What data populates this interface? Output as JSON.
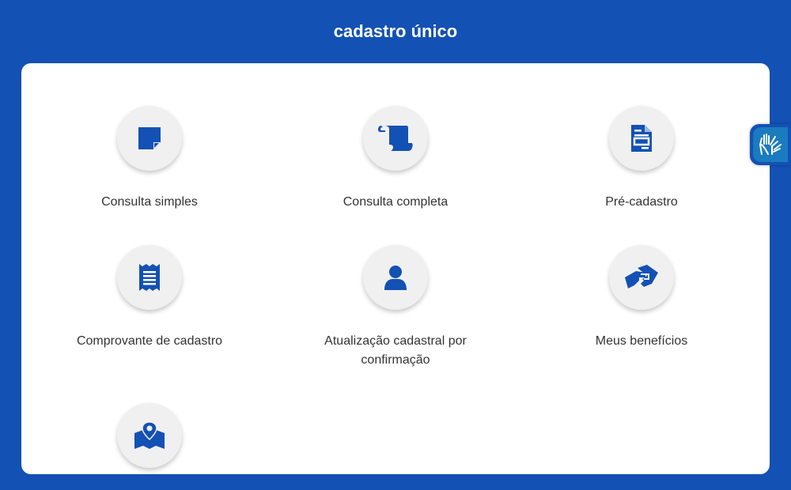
{
  "header": {
    "title": "cadastro único"
  },
  "services": [
    {
      "label": "Consulta simples",
      "icon": "sticky-note-icon"
    },
    {
      "label": "Consulta completa",
      "icon": "scroll-icon"
    },
    {
      "label": "Pré-cadastro",
      "icon": "file-form-icon"
    },
    {
      "label": "Comprovante de cadastro",
      "icon": "receipt-icon"
    },
    {
      "label": "Atualização cadastral por confirmação",
      "icon": "user-icon"
    },
    {
      "label": "Meus benefícios",
      "icon": "handshake-icon"
    },
    {
      "label": "",
      "icon": "map-marker-icon"
    }
  ],
  "accessibility": {
    "icon": "sign-language-hands-icon"
  },
  "colors": {
    "brand": "#1351b4",
    "icon": "#1351b4",
    "circle": "#f0f0f0",
    "text": "#333333"
  }
}
